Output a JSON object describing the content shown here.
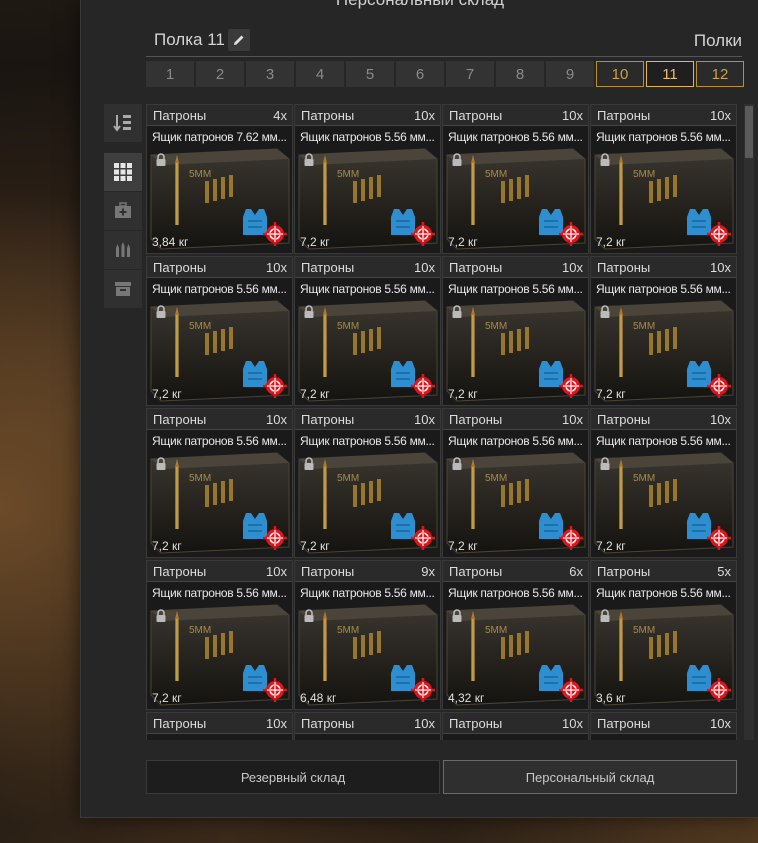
{
  "window_title": "Персональный склад",
  "header": {
    "shelf_name": "Полка 11",
    "shelves_label": "Полки"
  },
  "tabs": [
    {
      "label": "1",
      "state": "normal"
    },
    {
      "label": "2",
      "state": "normal"
    },
    {
      "label": "3",
      "state": "normal"
    },
    {
      "label": "4",
      "state": "normal"
    },
    {
      "label": "5",
      "state": "normal"
    },
    {
      "label": "6",
      "state": "normal"
    },
    {
      "label": "7",
      "state": "normal"
    },
    {
      "label": "8",
      "state": "normal"
    },
    {
      "label": "9",
      "state": "normal"
    },
    {
      "label": "10",
      "state": "gold"
    },
    {
      "label": "11",
      "state": "active"
    },
    {
      "label": "12",
      "state": "gold"
    }
  ],
  "sidebar": {
    "sort": [
      "sort-icon"
    ],
    "filters": [
      "grid-icon",
      "medkit-icon",
      "ammo-icon",
      "box-icon"
    ]
  },
  "items": [
    {
      "category": "Патроны",
      "qty": "4x",
      "name": "Ящик патронов 7.62 мм...",
      "weight": "3,84 кг"
    },
    {
      "category": "Патроны",
      "qty": "10x",
      "name": "Ящик патронов 5.56 мм...",
      "weight": "7,2 кг"
    },
    {
      "category": "Патроны",
      "qty": "10x",
      "name": "Ящик патронов 5.56 мм...",
      "weight": "7,2 кг"
    },
    {
      "category": "Патроны",
      "qty": "10x",
      "name": "Ящик патронов 5.56 мм...",
      "weight": "7,2 кг"
    },
    {
      "category": "Патроны",
      "qty": "10x",
      "name": "Ящик патронов 5.56 мм...",
      "weight": "7,2 кг"
    },
    {
      "category": "Патроны",
      "qty": "10x",
      "name": "Ящик патронов 5.56 мм...",
      "weight": "7,2 кг"
    },
    {
      "category": "Патроны",
      "qty": "10x",
      "name": "Ящик патронов 5.56 мм...",
      "weight": "7,2 кг"
    },
    {
      "category": "Патроны",
      "qty": "10x",
      "name": "Ящик патронов 5.56 мм...",
      "weight": "7,2 кг"
    },
    {
      "category": "Патроны",
      "qty": "10x",
      "name": "Ящик патронов 5.56 мм...",
      "weight": "7,2 кг"
    },
    {
      "category": "Патроны",
      "qty": "10x",
      "name": "Ящик патронов 5.56 мм...",
      "weight": "7,2 кг"
    },
    {
      "category": "Патроны",
      "qty": "10x",
      "name": "Ящик патронов 5.56 мм...",
      "weight": "7,2 кг"
    },
    {
      "category": "Патроны",
      "qty": "10x",
      "name": "Ящик патронов 5.56 мм...",
      "weight": "7,2 кг"
    },
    {
      "category": "Патроны",
      "qty": "10x",
      "name": "Ящик патронов 5.56 мм...",
      "weight": "7,2 кг"
    },
    {
      "category": "Патроны",
      "qty": "9x",
      "name": "Ящик патронов 5.56 мм...",
      "weight": "6,48 кг"
    },
    {
      "category": "Патроны",
      "qty": "6x",
      "name": "Ящик патронов 5.56 мм...",
      "weight": "4,32 кг"
    },
    {
      "category": "Патроны",
      "qty": "5x",
      "name": "Ящик патронов 5.56 мм...",
      "weight": "3,6 кг"
    },
    {
      "category": "Патроны",
      "qty": "10x",
      "name": "",
      "weight": ""
    },
    {
      "category": "Патроны",
      "qty": "10x",
      "name": "",
      "weight": ""
    },
    {
      "category": "Патроны",
      "qty": "10x",
      "name": "",
      "weight": ""
    },
    {
      "category": "Патроны",
      "qty": "10x",
      "name": "",
      "weight": ""
    }
  ],
  "bottom": {
    "reserve_label": "Резервный склад",
    "personal_label": "Персональный склад"
  },
  "colors": {
    "accent_gold": "#c9a24a",
    "lock": "#bbbbbb",
    "vest": "#2e8fd0",
    "target": "#e3121b"
  }
}
